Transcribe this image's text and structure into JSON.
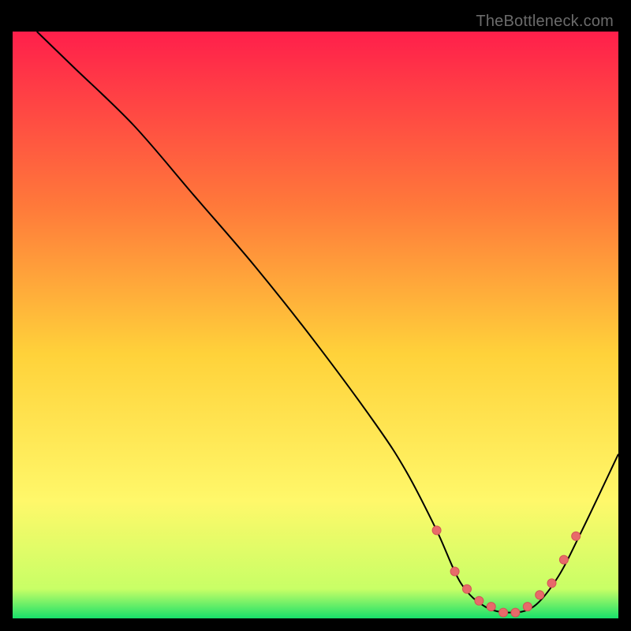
{
  "watermark": "TheBottleneck.com",
  "colors": {
    "gradient_top": "#ff1f4b",
    "gradient_mid1": "#ff7a3a",
    "gradient_mid2": "#ffd23a",
    "gradient_mid3": "#fff86a",
    "gradient_bottom": "#18e06a",
    "curve": "#000000",
    "marker": "#e86a6a",
    "marker_stroke": "#d35555"
  },
  "chart_data": {
    "type": "line",
    "title": "",
    "xlabel": "",
    "ylabel": "",
    "xlim": [
      0,
      100
    ],
    "ylim": [
      0,
      100
    ],
    "series": [
      {
        "name": "bottleneck-curve",
        "x": [
          4,
          10,
          20,
          30,
          40,
          50,
          60,
          65,
          70,
          74,
          78,
          82,
          86,
          90,
          94,
          100
        ],
        "y": [
          100,
          94,
          84,
          72,
          60,
          47,
          33,
          25,
          15,
          6,
          2,
          1,
          2,
          7,
          15,
          28
        ]
      }
    ],
    "highlight_markers": {
      "name": "optimal-range",
      "x": [
        70,
        73,
        75,
        77,
        79,
        81,
        83,
        85,
        87,
        89,
        91,
        93
      ],
      "y": [
        15,
        8,
        5,
        3,
        2,
        1,
        1,
        2,
        4,
        6,
        10,
        14
      ]
    },
    "gradient_stops_pct": [
      0,
      30,
      55,
      80,
      95,
      100
    ]
  }
}
